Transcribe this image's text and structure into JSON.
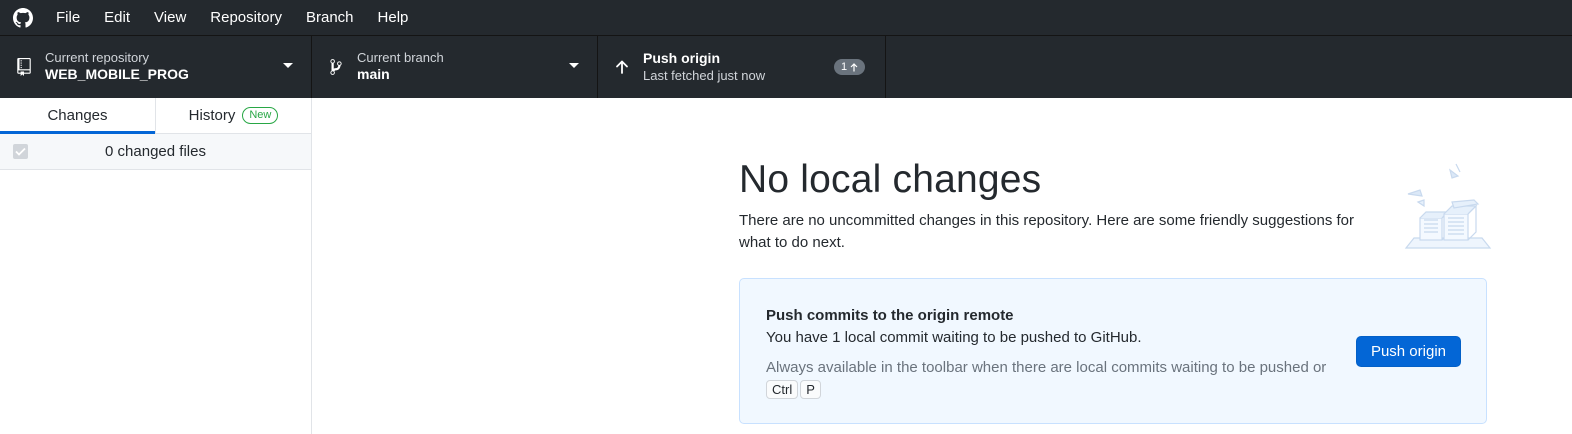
{
  "app": {
    "logo_icon": "github-octocat-icon"
  },
  "menu": [
    "File",
    "Edit",
    "View",
    "Repository",
    "Branch",
    "Help"
  ],
  "toolbar": {
    "repository": {
      "description": "Current repository",
      "title": "WEB_MOBILE_PROG",
      "icon": "repo-icon"
    },
    "branch": {
      "description": "Current branch",
      "title": "main",
      "icon": "git-branch-icon"
    },
    "push": {
      "title": "Push origin",
      "description": "Last fetched just now",
      "icon": "arrow-up-icon",
      "ahead_count": "1"
    }
  },
  "sidebar": {
    "tabs": [
      {
        "label": "Changes",
        "selected": true
      },
      {
        "label": "History",
        "badge": "New"
      }
    ],
    "changes_count": "0 changed files"
  },
  "main": {
    "heading": "No local changes",
    "intro": "There are no uncommitted changes in this repository. Here are some friendly suggestions for what to do next.",
    "card": {
      "title": "Push commits to the origin remote",
      "description": "You have 1 local commit waiting to be pushed to GitHub.",
      "hint": "Always available in the toolbar when there are local commits waiting to be pushed or",
      "shortcut_keys": [
        "Ctrl",
        "P"
      ],
      "button_label": "Push origin"
    }
  },
  "colors": {
    "toolbar_bg": "#24292e",
    "accent_blue": "#0366d6",
    "badge_green": "#28a745",
    "card_bg": "#f1f8ff",
    "card_border": "#c8e1ff"
  }
}
